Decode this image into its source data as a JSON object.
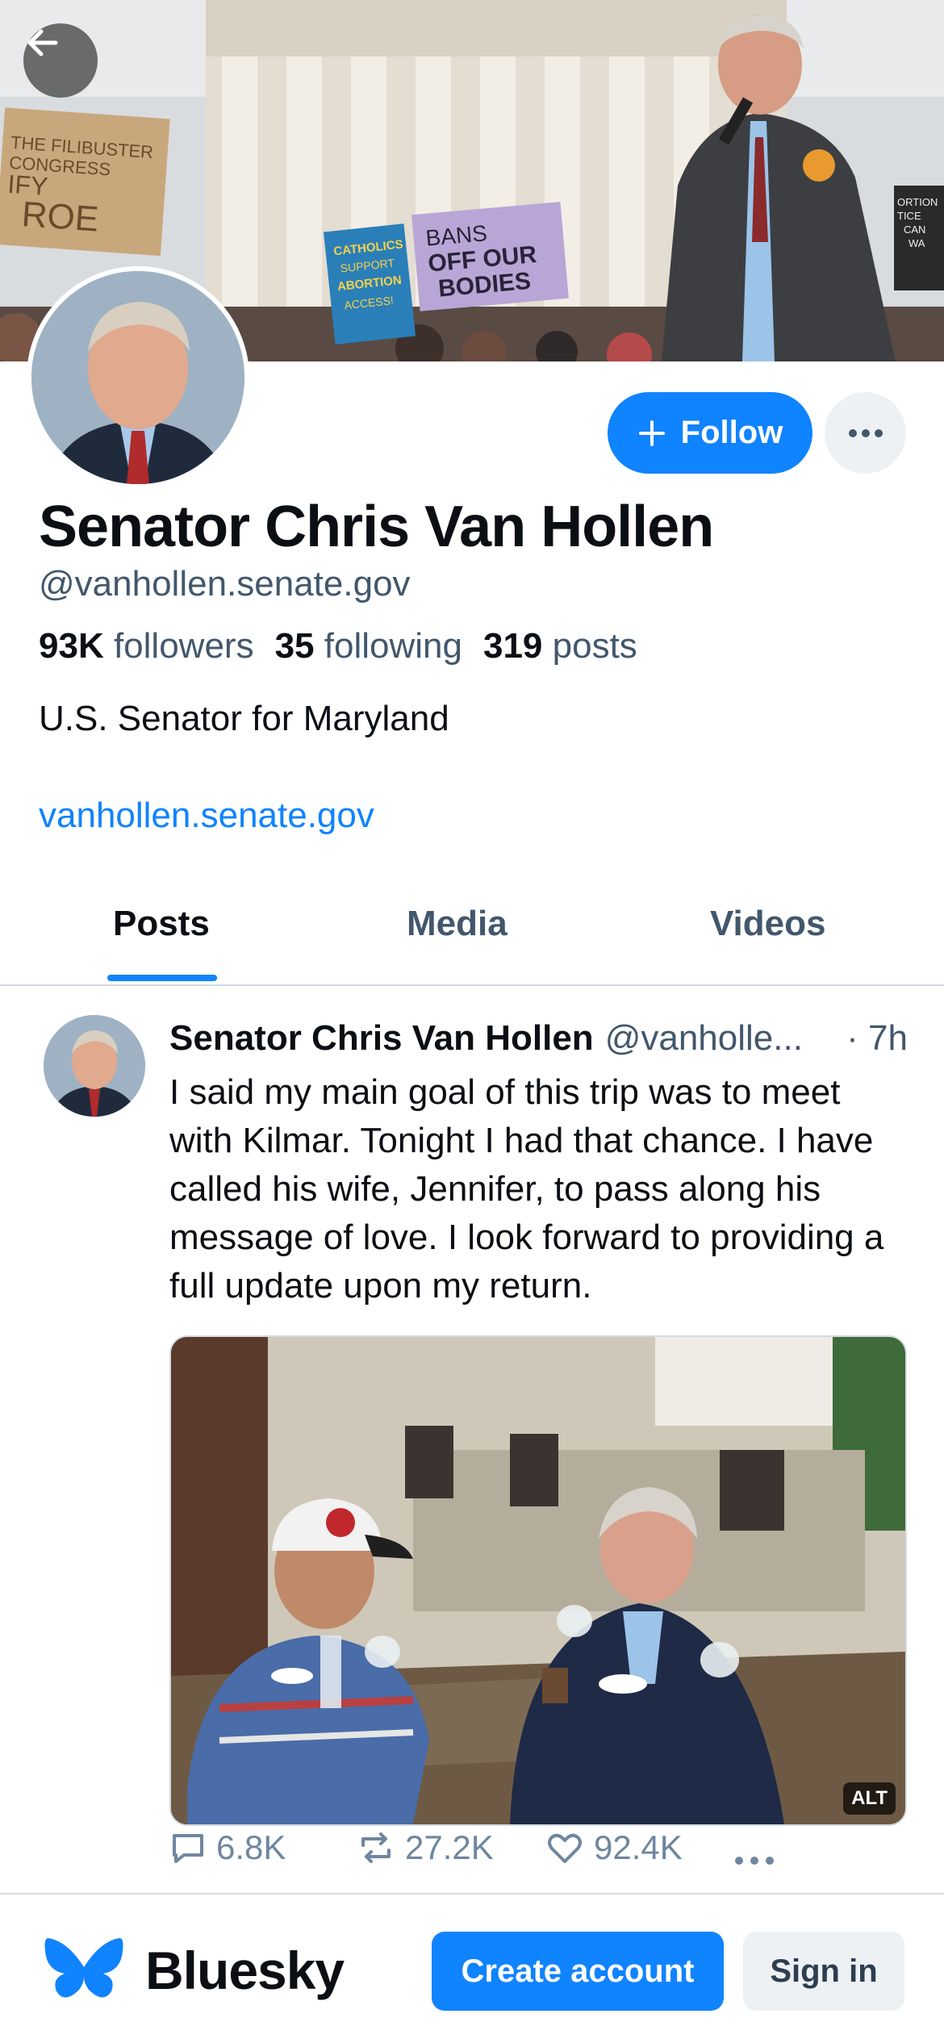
{
  "profile": {
    "display_name": "Senator Chris Van Hollen",
    "handle": "@vanhollen.senate.gov",
    "followers_count": "93K",
    "followers_label": "followers",
    "following_count": "35",
    "following_label": "following",
    "posts_count": "319",
    "posts_label": "posts",
    "bio": "U.S. Senator for Maryland",
    "link": "vanhollen.senate.gov",
    "follow_label": "Follow"
  },
  "banner": {
    "sign_left": "THE FILIBUSTER CONGRESS IFY ROE",
    "sign_blue": "CATHOLICS SUPPORT ABORTION ACCESS!",
    "sign_purple_line1": "BANS",
    "sign_purple_line2": "OFF OUR",
    "sign_purple_line3": "BODIES",
    "sign_right": "ORTION TICE CAN WA"
  },
  "tabs": [
    {
      "label": "Posts",
      "active": true
    },
    {
      "label": "Media",
      "active": false
    },
    {
      "label": "Videos",
      "active": false
    }
  ],
  "post": {
    "author": "Senator Chris Van Hollen",
    "handle": "@vanholle...",
    "time": "· 7h",
    "text": "I said my main goal of this trip was to meet with Kilmar. Tonight I had that chance. I have called his wife, Jennifer, to pass along his message of love. I look forward to providing a full update upon my return.",
    "alt_badge": "ALT",
    "replies": "6.8K",
    "reposts": "27.2K",
    "likes": "92.4K"
  },
  "bottom_bar": {
    "brand": "Bluesky",
    "create_label": "Create account",
    "signin_label": "Sign in"
  },
  "colors": {
    "accent": "#1083fe",
    "muted": "#42576c",
    "border": "#d4dbe2"
  }
}
